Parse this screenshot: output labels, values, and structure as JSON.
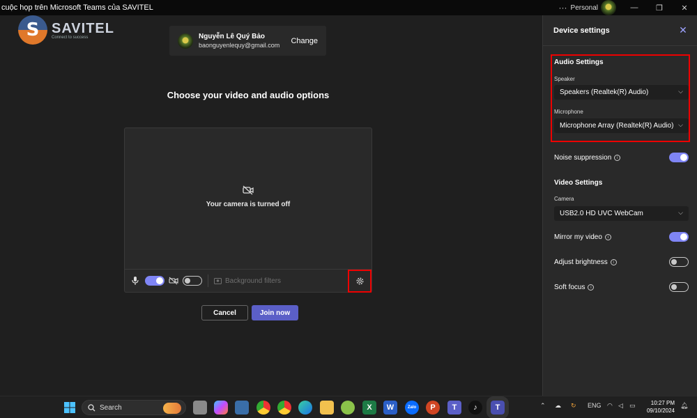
{
  "window": {
    "title": "cuộc họp trên Microsoft Teams của SAVITEL",
    "profile_label": "Personal",
    "more_glyph": "···",
    "minimize_glyph": "—",
    "restore_glyph": "❐",
    "close_glyph": "✕"
  },
  "logo": {
    "letter": "S",
    "name": "SAVITEL",
    "tagline": "Connect to success"
  },
  "account": {
    "name": "Nguyễn Lê Quý Bảo",
    "email": "baonguyenlequy@gmail.com",
    "change_label": "Change"
  },
  "prejoin": {
    "heading": "Choose your video and audio options",
    "camera_off_text": "Your camera is turned off",
    "mic_on": true,
    "camera_on": false,
    "background_filters_label": "Background filters",
    "cancel_label": "Cancel",
    "join_label": "Join now"
  },
  "device_settings": {
    "title": "Device settings",
    "close_glyph": "✕",
    "audio_heading": "Audio Settings",
    "speaker_label": "Speaker",
    "speaker_value": "Speakers (Realtek(R) Audio)",
    "microphone_label": "Microphone",
    "microphone_value": "Microphone Array (Realtek(R) Audio)",
    "noise_suppression_label": "Noise suppression",
    "noise_suppression_on": true,
    "video_heading": "Video Settings",
    "camera_label": "Camera",
    "camera_value": "USB2.0 HD UVC WebCam",
    "mirror_label": "Mirror my video",
    "mirror_on": true,
    "brightness_label": "Adjust brightness",
    "brightness_on": false,
    "soft_focus_label": "Soft focus",
    "soft_focus_on": false,
    "info_glyph": "i",
    "chevron_glyph": "⌵"
  },
  "taskbar": {
    "search_label": "Search",
    "excel_glyph": "X",
    "word_glyph": "W",
    "zalo_glyph": "Zalo",
    "ppt_glyph": "P",
    "teams_glyph": "T",
    "tiktok_glyph": "♪",
    "language": "ENG",
    "time": "10:27 PM",
    "date": "09/10/2024"
  },
  "colors": {
    "accent": "#5b5fc7",
    "toggle_on": "#7f85f5",
    "highlight": "#e00000"
  }
}
